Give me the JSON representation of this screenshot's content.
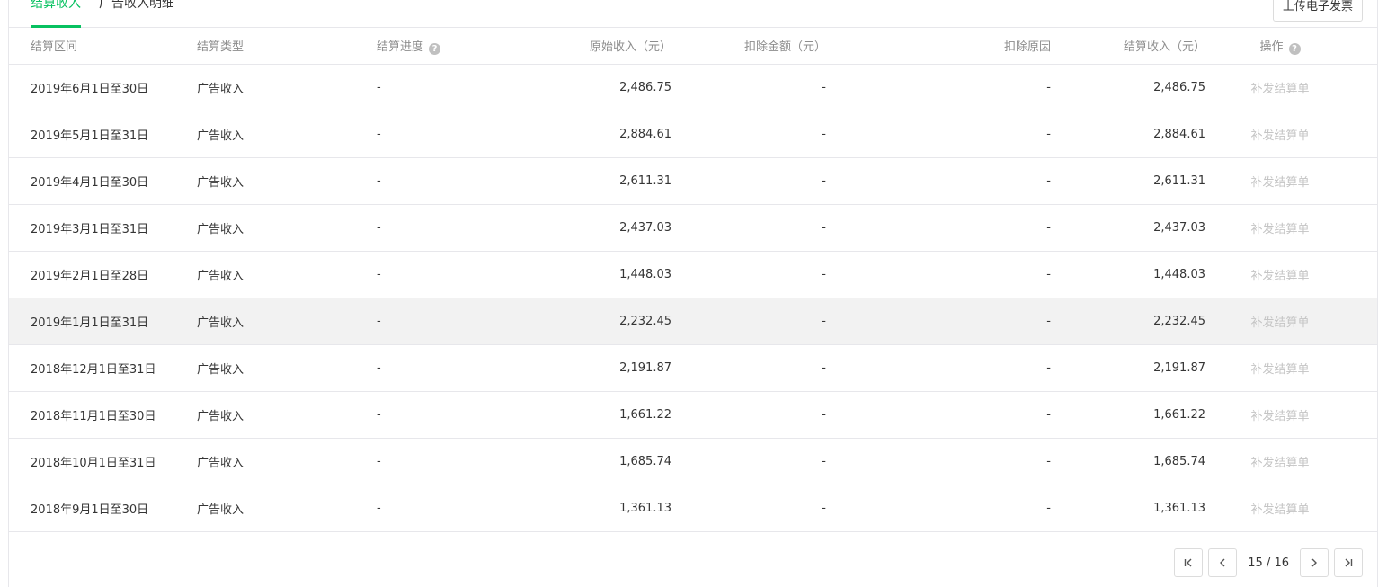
{
  "tabs": [
    {
      "label": "结算收入"
    },
    {
      "label": "广告收入明细"
    }
  ],
  "upload_button": "上传电子发票",
  "columns": [
    "结算区间",
    "结算类型",
    "结算进度",
    "原始收入（元）",
    "扣除金额（元）",
    "扣除原因",
    "结算收入（元）",
    "操作"
  ],
  "rows": [
    {
      "period": "2019年6月1日至30日",
      "type": "广告收入",
      "progress": "-",
      "original": "2,486.75",
      "deduction": "-",
      "reason": "-",
      "settled": "2,486.75",
      "action": "补发结算单"
    },
    {
      "period": "2019年5月1日至31日",
      "type": "广告收入",
      "progress": "-",
      "original": "2,884.61",
      "deduction": "-",
      "reason": "-",
      "settled": "2,884.61",
      "action": "补发结算单"
    },
    {
      "period": "2019年4月1日至30日",
      "type": "广告收入",
      "progress": "-",
      "original": "2,611.31",
      "deduction": "-",
      "reason": "-",
      "settled": "2,611.31",
      "action": "补发结算单"
    },
    {
      "period": "2019年3月1日至31日",
      "type": "广告收入",
      "progress": "-",
      "original": "2,437.03",
      "deduction": "-",
      "reason": "-",
      "settled": "2,437.03",
      "action": "补发结算单"
    },
    {
      "period": "2019年2月1日至28日",
      "type": "广告收入",
      "progress": "-",
      "original": "1,448.03",
      "deduction": "-",
      "reason": "-",
      "settled": "1,448.03",
      "action": "补发结算单"
    },
    {
      "period": "2019年1月1日至31日",
      "type": "广告收入",
      "progress": "-",
      "original": "2,232.45",
      "deduction": "-",
      "reason": "-",
      "settled": "2,232.45",
      "action": "补发结算单"
    },
    {
      "period": "2018年12月1日至31日",
      "type": "广告收入",
      "progress": "-",
      "original": "2,191.87",
      "deduction": "-",
      "reason": "-",
      "settled": "2,191.87",
      "action": "补发结算单"
    },
    {
      "period": "2018年11月1日至30日",
      "type": "广告收入",
      "progress": "-",
      "original": "1,661.22",
      "deduction": "-",
      "reason": "-",
      "settled": "1,661.22",
      "action": "补发结算单"
    },
    {
      "period": "2018年10月1日至31日",
      "type": "广告收入",
      "progress": "-",
      "original": "1,685.74",
      "deduction": "-",
      "reason": "-",
      "settled": "1,685.74",
      "action": "补发结算单"
    },
    {
      "period": "2018年9月1日至30日",
      "type": "广告收入",
      "progress": "-",
      "original": "1,361.13",
      "deduction": "-",
      "reason": "-",
      "settled": "1,361.13",
      "action": "补发结算单"
    }
  ],
  "pagination": {
    "current": "15",
    "total": "16",
    "separator": " / "
  }
}
